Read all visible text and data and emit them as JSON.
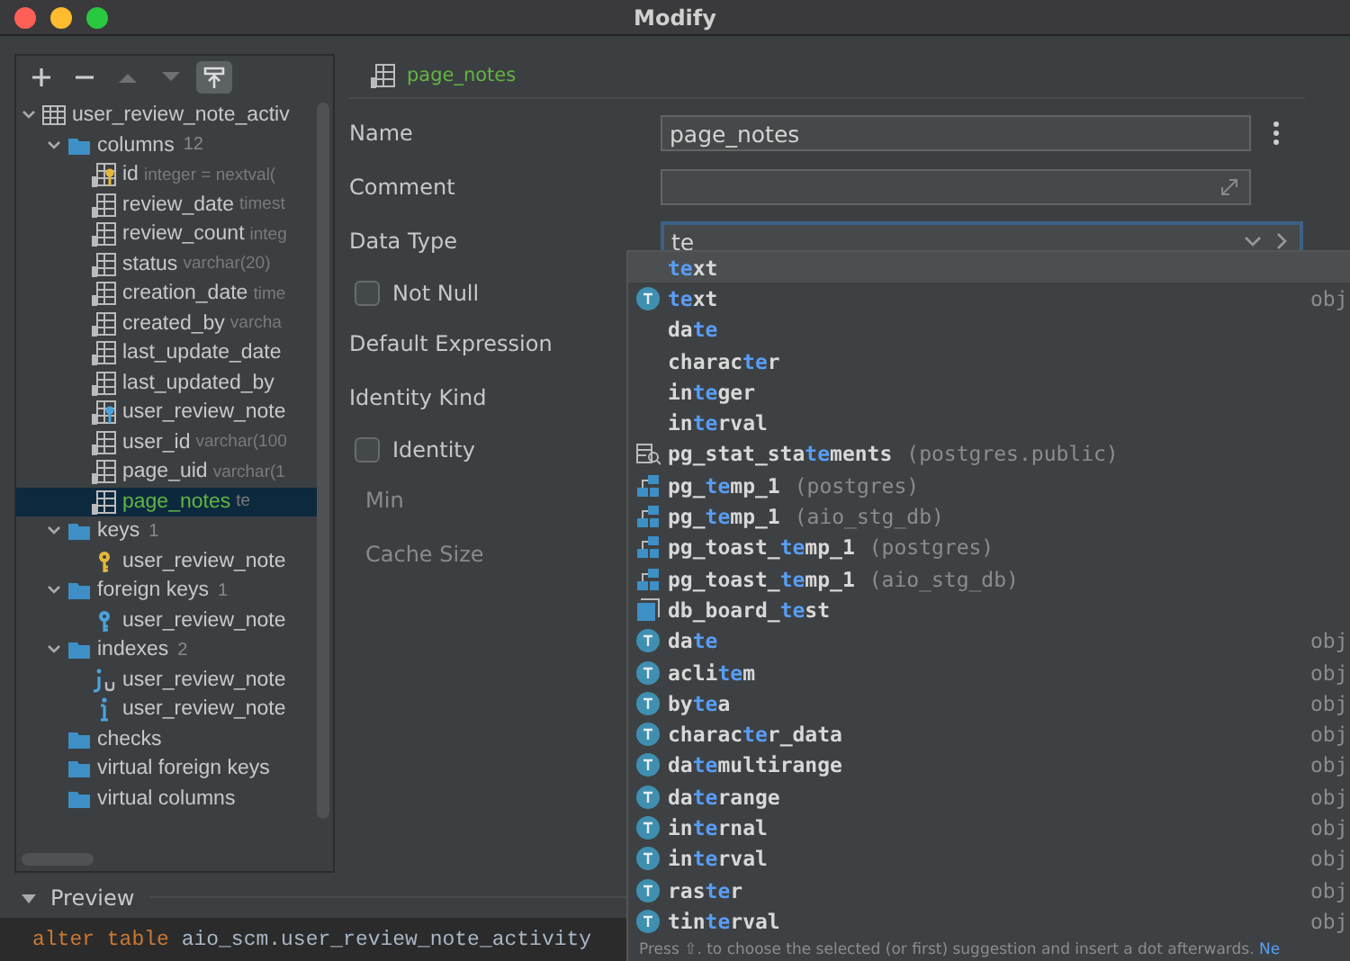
{
  "window": {
    "title": "Modify"
  },
  "toolbar": [
    {
      "kind": "add",
      "disabled": false
    },
    {
      "kind": "remove",
      "disabled": false
    },
    {
      "kind": "up",
      "disabled": true
    },
    {
      "kind": "down",
      "disabled": true
    },
    {
      "kind": "pin",
      "disabled": false
    }
  ],
  "tree": [
    {
      "kind": "table",
      "label": "user_review_note_activ",
      "expanded": true,
      "selected": false,
      "children": [
        {
          "kind": "folder",
          "label": "columns",
          "count": "12",
          "expanded": true,
          "selected": false,
          "children": [
            {
              "kind": "column_pk",
              "label": "id",
              "detail": "integer = nextval(",
              "selected": false
            },
            {
              "kind": "column",
              "label": "review_date",
              "detail": "timest",
              "selected": false
            },
            {
              "kind": "column",
              "label": "review_count",
              "detail": "integ",
              "selected": false
            },
            {
              "kind": "column",
              "label": "status",
              "detail": "varchar(20)",
              "selected": false
            },
            {
              "kind": "column",
              "label": "creation_date",
              "detail": "time",
              "selected": false
            },
            {
              "kind": "column",
              "label": "created_by",
              "detail": "varcha",
              "selected": false
            },
            {
              "kind": "column",
              "label": "last_update_date",
              "selected": false
            },
            {
              "kind": "column",
              "label": "last_updated_by",
              "selected": false
            },
            {
              "kind": "column_fk",
              "label": "user_review_note",
              "selected": false
            },
            {
              "kind": "column",
              "label": "user_id",
              "detail": "varchar(100",
              "selected": false
            },
            {
              "kind": "column",
              "label": "page_uid",
              "detail": "varchar(1",
              "selected": false
            },
            {
              "kind": "column",
              "label": "page_notes",
              "detail": "te",
              "selected": true
            }
          ]
        },
        {
          "kind": "folder",
          "label": "keys",
          "count": "1",
          "expanded": true,
          "selected": false,
          "children": [
            {
              "kind": "key",
              "label": "user_review_note",
              "selected": false
            }
          ]
        },
        {
          "kind": "folder",
          "label": "foreign keys",
          "count": "1",
          "expanded": true,
          "selected": false,
          "children": [
            {
              "kind": "fkey",
              "label": "user_review_note",
              "selected": false
            }
          ]
        },
        {
          "kind": "folder",
          "label": "indexes",
          "count": "2",
          "expanded": true,
          "selected": false,
          "children": [
            {
              "kind": "index_unique",
              "label": "user_review_note",
              "selected": false
            },
            {
              "kind": "index",
              "label": "user_review_note",
              "selected": false
            }
          ]
        },
        {
          "kind": "folder",
          "label": "checks",
          "selected": false
        },
        {
          "kind": "folder",
          "label": "virtual foreign keys",
          "selected": false
        },
        {
          "kind": "folder",
          "label": "virtual columns",
          "selected": false
        }
      ]
    }
  ],
  "preview": {
    "title": "Preview",
    "expanded": true,
    "code": [
      {
        "text": "alter table",
        "kind": "keyword"
      },
      {
        "text": " aio_scm.user_review_note_activity",
        "kind": "plain"
      }
    ]
  },
  "form": {
    "breadcrumb": "page_notes",
    "fields": [
      {
        "kind": "text",
        "label": "Name",
        "value": "page_notes",
        "focused": false
      },
      {
        "kind": "expand",
        "label": "Comment",
        "focused": false
      },
      {
        "kind": "combo",
        "label": "Data Type",
        "value": "te",
        "focused": true
      },
      {
        "kind": "checkbox",
        "label": "Not Null",
        "checked": false,
        "disabled": false
      },
      {
        "kind": "label",
        "label": "Default Expression",
        "disabled": false
      },
      {
        "kind": "label",
        "label": "Identity Kind",
        "disabled": false
      },
      {
        "kind": "checkbox",
        "label": "Identity",
        "checked": false,
        "disabled": false
      },
      {
        "kind": "label",
        "label": "Min",
        "disabled": true
      },
      {
        "kind": "label",
        "label": "Cache Size",
        "disabled": true
      }
    ]
  },
  "completion": {
    "items": [
      {
        "kind": "plain",
        "parts": [
          {
            "text": "te",
            "match": true
          },
          {
            "text": "xt",
            "match": false
          }
        ],
        "selected": true
      },
      {
        "kind": "type",
        "parts": [
          {
            "text": "te",
            "match": true
          },
          {
            "text": "xt",
            "match": false
          }
        ],
        "type_text": "obj",
        "selected": false
      },
      {
        "kind": "plain",
        "parts": [
          {
            "text": "da",
            "match": false
          },
          {
            "text": "te",
            "match": true
          }
        ],
        "selected": false
      },
      {
        "kind": "plain",
        "parts": [
          {
            "text": "charac",
            "match": false
          },
          {
            "text": "te",
            "match": true
          },
          {
            "text": "r",
            "match": false
          }
        ],
        "selected": false
      },
      {
        "kind": "plain",
        "parts": [
          {
            "text": "in",
            "match": false
          },
          {
            "text": "te",
            "match": true
          },
          {
            "text": "ger",
            "match": false
          }
        ],
        "selected": false
      },
      {
        "kind": "plain",
        "parts": [
          {
            "text": "in",
            "match": false
          },
          {
            "text": "te",
            "match": true
          },
          {
            "text": "rval",
            "match": false
          }
        ],
        "selected": false
      },
      {
        "kind": "view",
        "parts": [
          {
            "text": "pg_stat_sta",
            "match": false
          },
          {
            "text": "te",
            "match": true
          },
          {
            "text": "ments",
            "match": false
          }
        ],
        "location": "(postgres.public)",
        "selected": false
      },
      {
        "kind": "schema",
        "parts": [
          {
            "text": "pg_",
            "match": false
          },
          {
            "text": "te",
            "match": true
          },
          {
            "text": "mp_1",
            "match": false
          }
        ],
        "location": "(postgres)",
        "selected": false
      },
      {
        "kind": "schema",
        "parts": [
          {
            "text": "pg_",
            "match": false
          },
          {
            "text": "te",
            "match": true
          },
          {
            "text": "mp_1",
            "match": false
          }
        ],
        "location": "(aio_stg_db)",
        "selected": false
      },
      {
        "kind": "schema",
        "parts": [
          {
            "text": "pg_toast_",
            "match": false
          },
          {
            "text": "te",
            "match": true
          },
          {
            "text": "mp_1",
            "match": false
          }
        ],
        "location": "(postgres)",
        "selected": false
      },
      {
        "kind": "schema",
        "parts": [
          {
            "text": "pg_toast_",
            "match": false
          },
          {
            "text": "te",
            "match": true
          },
          {
            "text": "mp_1",
            "match": false
          }
        ],
        "location": "(aio_stg_db)",
        "selected": false
      },
      {
        "kind": "database",
        "parts": [
          {
            "text": "db_board_",
            "match": false
          },
          {
            "text": "te",
            "match": true
          },
          {
            "text": "st",
            "match": false
          }
        ],
        "selected": false
      },
      {
        "kind": "type",
        "parts": [
          {
            "text": "da",
            "match": false
          },
          {
            "text": "te",
            "match": true
          }
        ],
        "type_text": "obj",
        "selected": false
      },
      {
        "kind": "type",
        "parts": [
          {
            "text": "acli",
            "match": false
          },
          {
            "text": "te",
            "match": true
          },
          {
            "text": "m",
            "match": false
          }
        ],
        "type_text": "obj",
        "selected": false
      },
      {
        "kind": "type",
        "parts": [
          {
            "text": "by",
            "match": false
          },
          {
            "text": "te",
            "match": true
          },
          {
            "text": "a",
            "match": false
          }
        ],
        "type_text": "obj",
        "selected": false
      },
      {
        "kind": "type",
        "parts": [
          {
            "text": "charac",
            "match": false
          },
          {
            "text": "te",
            "match": true
          },
          {
            "text": "r_data",
            "match": false
          }
        ],
        "type_text": "obj",
        "selected": false
      },
      {
        "kind": "type",
        "parts": [
          {
            "text": "da",
            "match": false
          },
          {
            "text": "te",
            "match": true
          },
          {
            "text": "multirange",
            "match": false
          }
        ],
        "type_text": "obj",
        "selected": false
      },
      {
        "kind": "type",
        "parts": [
          {
            "text": "da",
            "match": false
          },
          {
            "text": "te",
            "match": true
          },
          {
            "text": "range",
            "match": false
          }
        ],
        "type_text": "obj",
        "selected": false
      },
      {
        "kind": "type",
        "parts": [
          {
            "text": "in",
            "match": false
          },
          {
            "text": "te",
            "match": true
          },
          {
            "text": "rnal",
            "match": false
          }
        ],
        "type_text": "obj",
        "selected": false
      },
      {
        "kind": "type",
        "parts": [
          {
            "text": "in",
            "match": false
          },
          {
            "text": "te",
            "match": true
          },
          {
            "text": "rval",
            "match": false
          }
        ],
        "type_text": "obj",
        "selected": false
      },
      {
        "kind": "type",
        "parts": [
          {
            "text": "ras",
            "match": false
          },
          {
            "text": "te",
            "match": true
          },
          {
            "text": "r",
            "match": false
          }
        ],
        "type_text": "obj",
        "selected": false
      },
      {
        "kind": "type",
        "parts": [
          {
            "text": "tin",
            "match": false
          },
          {
            "text": "te",
            "match": true
          },
          {
            "text": "rval",
            "match": false
          }
        ],
        "type_text": "obj",
        "selected": false
      }
    ],
    "hint": "Press ⇧. to choose the selected (or first) suggestion and insert a dot afterwards.",
    "hint_link": "Ne"
  }
}
